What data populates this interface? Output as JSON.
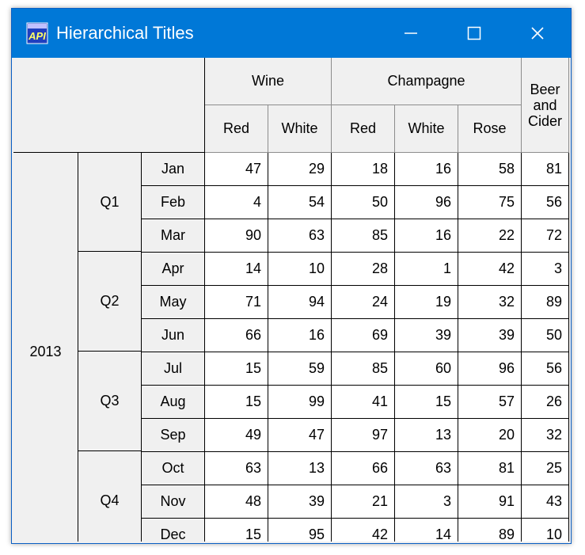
{
  "window": {
    "title": "Hierarchical Titles",
    "icon": "api-app-icon",
    "controls": [
      "minimize",
      "maximize",
      "close"
    ]
  },
  "grid": {
    "top_headers": [
      "Wine",
      "Champagne",
      "Beer and Cider"
    ],
    "beer_lines": [
      "Beer",
      "and",
      "Cider"
    ],
    "sub_headers": [
      "Red",
      "White",
      "Red",
      "White",
      "Rose"
    ],
    "year": "2013",
    "quarters": [
      "Q1",
      "Q2",
      "Q3",
      "Q4"
    ],
    "rows": [
      {
        "month": "Jan",
        "values": [
          "47",
          "29",
          "18",
          "16",
          "58",
          "81"
        ]
      },
      {
        "month": "Feb",
        "values": [
          "4",
          "54",
          "50",
          "96",
          "75",
          "56"
        ]
      },
      {
        "month": "Mar",
        "values": [
          "90",
          "63",
          "85",
          "16",
          "22",
          "72"
        ]
      },
      {
        "month": "Apr",
        "values": [
          "14",
          "10",
          "28",
          "1",
          "42",
          "3"
        ]
      },
      {
        "month": "May",
        "values": [
          "71",
          "94",
          "24",
          "19",
          "32",
          "89"
        ]
      },
      {
        "month": "Jun",
        "values": [
          "66",
          "16",
          "69",
          "39",
          "39",
          "50"
        ]
      },
      {
        "month": "Jul",
        "values": [
          "15",
          "59",
          "85",
          "60",
          "96",
          "56"
        ]
      },
      {
        "month": "Aug",
        "values": [
          "15",
          "99",
          "41",
          "15",
          "57",
          "26"
        ]
      },
      {
        "month": "Sep",
        "values": [
          "49",
          "47",
          "97",
          "13",
          "20",
          "32"
        ]
      },
      {
        "month": "Oct",
        "values": [
          "63",
          "13",
          "66",
          "63",
          "81",
          "25"
        ]
      },
      {
        "month": "Nov",
        "values": [
          "48",
          "39",
          "21",
          "3",
          "91",
          "43"
        ]
      },
      {
        "month": "Dec",
        "values": [
          "15",
          "95",
          "42",
          "14",
          "89",
          "10"
        ]
      }
    ]
  }
}
